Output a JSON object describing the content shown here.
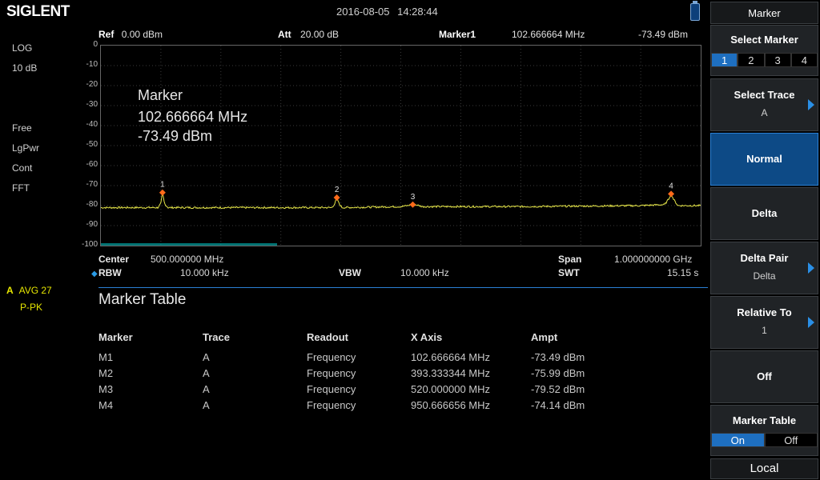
{
  "header": {
    "brand": "SIGLENT",
    "datetime": "2016-08-05   14:28:44",
    "usb_icon": "usb-drive-icon"
  },
  "left": {
    "scale_type": "LOG",
    "scale_div": "10 dB",
    "trigger": "Free",
    "detector": "LgPwr",
    "sweep": "Cont",
    "mode": "FFT",
    "trace_letter": "A",
    "trace_avg": "AVG 27",
    "trace_det": "P-PK"
  },
  "plot_header": {
    "ref_label": "Ref",
    "ref_value": "0.00 dBm",
    "att_label": "Att",
    "att_value": "20.00 dB",
    "marker_label": "Marker1",
    "marker_freq": "102.666664 MHz",
    "marker_ampl": "-73.49 dBm"
  },
  "marker_readout": {
    "title": "Marker",
    "freq": "102.666664 MHz",
    "ampl": "-73.49 dBm"
  },
  "footer": {
    "center_label": "Center",
    "center_value": "500.000000 MHz",
    "span_label": "Span",
    "span_value": "1.000000000 GHz",
    "rbw_label": "RBW",
    "rbw_value": "10.000 kHz",
    "vbw_label": "VBW",
    "vbw_value": "10.000 kHz",
    "swt_label": "SWT",
    "swt_value": "15.15 s"
  },
  "marker_table": {
    "title": "Marker Table",
    "headers": [
      "Marker",
      "Trace",
      "Readout",
      "X Axis",
      "Ampt"
    ],
    "rows": [
      [
        "M1",
        "A",
        "Frequency",
        "102.666664 MHz",
        "-73.49 dBm"
      ],
      [
        "M2",
        "A",
        "Frequency",
        "393.333344 MHz",
        "-75.99 dBm"
      ],
      [
        "M3",
        "A",
        "Frequency",
        "520.000000 MHz",
        "-79.52 dBm"
      ],
      [
        "M4",
        "A",
        "Frequency",
        "950.666656 MHz",
        "-74.14 dBm"
      ]
    ]
  },
  "softkeys": {
    "menu_title": "Marker",
    "select_marker_label": "Select Marker",
    "select_marker_options": [
      "1",
      "2",
      "3",
      "4"
    ],
    "select_trace_label": "Select Trace",
    "select_trace_value": "A",
    "normal_label": "Normal",
    "delta_label": "Delta",
    "delta_pair_label": "Delta Pair",
    "delta_pair_value": "Delta",
    "relative_to_label": "Relative To",
    "relative_to_value": "1",
    "off_label": "Off",
    "marker_table_label": "Marker Table",
    "marker_table_on": "On",
    "marker_table_off": "Off",
    "local_label": "Local"
  },
  "chart_data": {
    "type": "line",
    "xlabel": "",
    "ylabel": "",
    "ylim": [
      -100,
      0
    ],
    "xlim": [
      0,
      1000
    ],
    "y_ticks": [
      "0",
      "-10",
      "-20",
      "-30",
      "-40",
      "-50",
      "-60",
      "-70",
      "-80",
      "-90",
      "-100"
    ],
    "grid": true,
    "trace_color": "#e8e84a",
    "marker_color": "#ff6a1a",
    "noise_floor_dbm": -81,
    "series": [
      {
        "x": [
          0,
          95,
          100,
          102.67,
          106,
          112,
          200,
          385,
          390,
          393.33,
          397,
          402,
          500,
          512,
          516,
          520,
          524,
          528,
          536,
          700,
          900,
          940,
          946,
          950.67,
          955,
          962,
          1000
        ],
        "y": [
          -81,
          -81,
          -79,
          -73.49,
          -79,
          -81,
          -81,
          -81,
          -79,
          -75.99,
          -79,
          -81,
          -80.5,
          -80,
          -79.6,
          -79.52,
          -79.6,
          -79.8,
          -80.5,
          -80.5,
          -80,
          -79.5,
          -77,
          -74.14,
          -77,
          -80,
          -80
        ]
      }
    ],
    "markers": [
      {
        "label": "1",
        "x": 102.666664,
        "y": -73.49
      },
      {
        "label": "2",
        "x": 393.333344,
        "y": -75.99
      },
      {
        "label": "3",
        "x": 520.0,
        "y": -79.52
      },
      {
        "label": "4",
        "x": 950.666656,
        "y": -74.14
      }
    ]
  }
}
